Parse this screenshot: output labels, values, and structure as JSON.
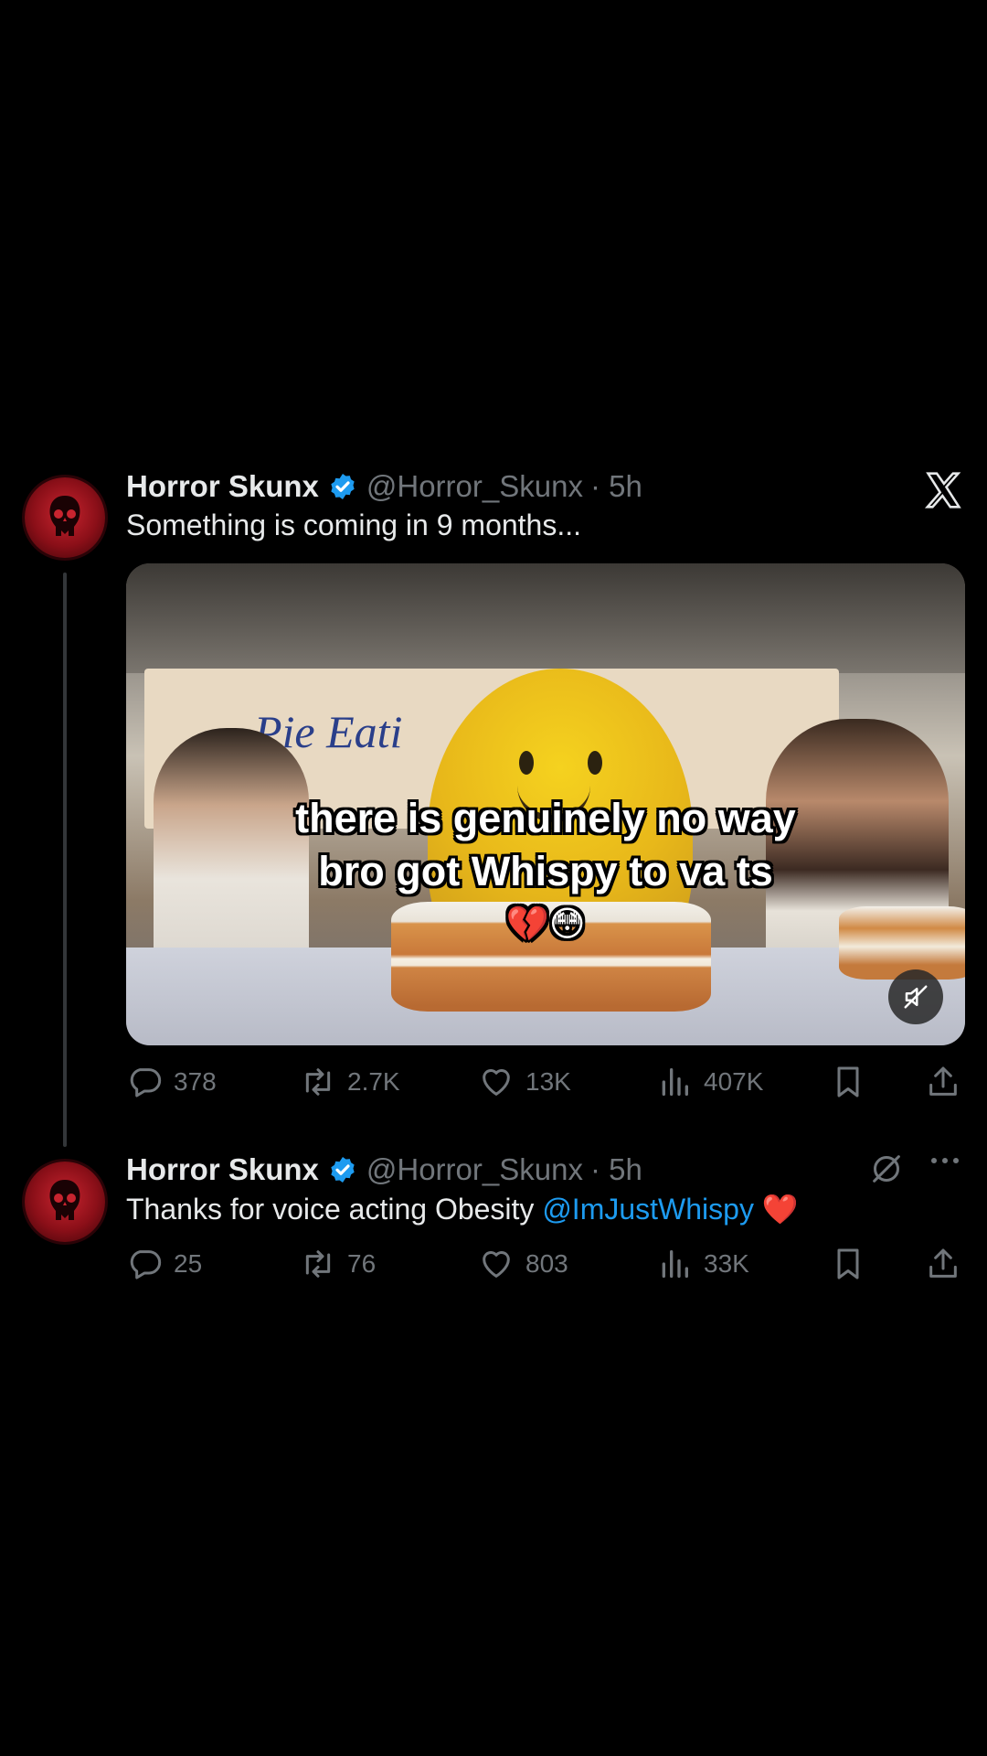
{
  "tweet1": {
    "name": "Horror Skunx",
    "handle": "@Horror_Skunx",
    "time": "· 5h",
    "text": "Something is coming in 9 months...",
    "media": {
      "banner_text": "Pie Eati",
      "caption_line1": "there is genuinely no way",
      "caption_line2": "bro got Whispy to va ts",
      "caption_emoji": "💔😳"
    },
    "replies": "378",
    "reposts": "2.7K",
    "likes": "13K",
    "views": "407K"
  },
  "tweet2": {
    "name": "Horror Skunx",
    "handle": "@Horror_Skunx",
    "time": "· 5h",
    "text_prefix": "Thanks for voice acting Obesity ",
    "mention": "@ImJustWhispy",
    "emoji": " ❤️",
    "replies": "25",
    "reposts": "76",
    "likes": "803",
    "views": "33K"
  },
  "icons": [
    "x-logo-icon",
    "verified-badge-icon",
    "reply-icon",
    "repost-icon",
    "like-icon",
    "views-icon",
    "bookmark-icon",
    "share-icon",
    "mute-icon",
    "grok-icon",
    "more-icon"
  ],
  "colors": {
    "background": "#000000",
    "text": "#e7e9ea",
    "secondary": "#71767b",
    "link": "#1d9bf0",
    "verified": "#1d9bf0"
  }
}
